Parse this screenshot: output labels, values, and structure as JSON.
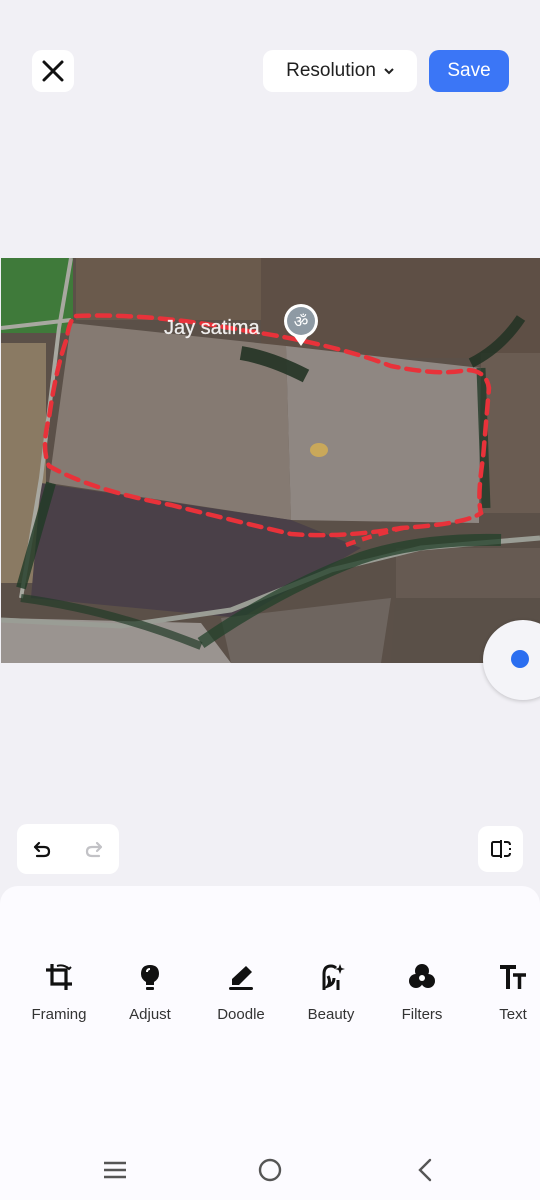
{
  "toolbar": {
    "close_icon": "close-icon",
    "resolution_label": "Resolution",
    "save_label": "Save"
  },
  "photo": {
    "place_label": "Jay satima",
    "place_icon": "om-symbol-icon"
  },
  "history": {
    "undo_icon": "undo-icon",
    "redo_icon": "redo-icon",
    "compare_icon": "compare-icon"
  },
  "tools": [
    {
      "label": "Framing",
      "icon": "framing-icon"
    },
    {
      "label": "Adjust",
      "icon": "adjust-icon"
    },
    {
      "label": "Doodle",
      "icon": "doodle-icon"
    },
    {
      "label": "Beauty",
      "icon": "beauty-icon"
    },
    {
      "label": "Filters",
      "icon": "filters-icon"
    },
    {
      "label": "Text",
      "icon": "text-icon"
    }
  ],
  "colors": {
    "accent": "#3b76f6",
    "boundary": "#e8323a",
    "background": "#f1f0f5"
  },
  "nav": [
    "menu-icon",
    "home-icon",
    "back-icon"
  ]
}
